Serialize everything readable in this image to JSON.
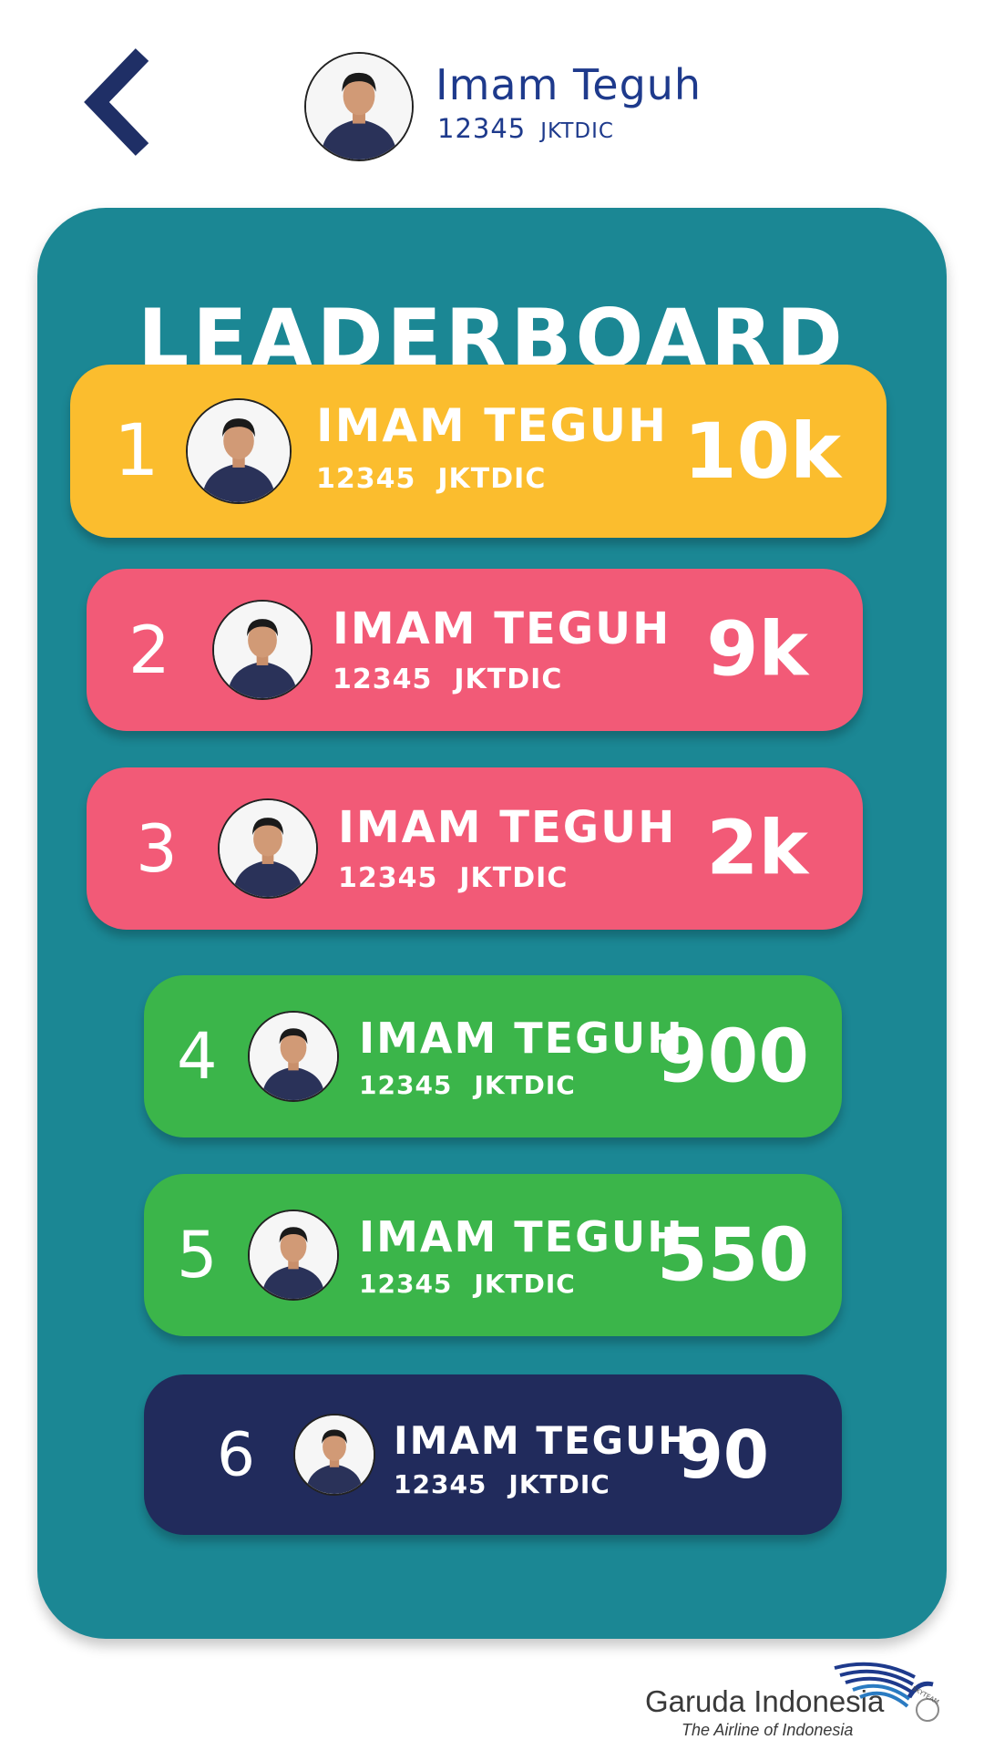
{
  "header": {
    "name": "Imam Teguh",
    "employee_id": "12345",
    "station": "JKTDIC"
  },
  "leaderboard": {
    "title": "LEADERBOARD",
    "entries": [
      {
        "rank": "1",
        "name": "IMAM TEGUH",
        "employee_id": "12345",
        "station": "JKTDIC",
        "score": "10k",
        "color": "#fbbd2e"
      },
      {
        "rank": "2",
        "name": "IMAM TEGUH",
        "employee_id": "12345",
        "station": "JKTDIC",
        "score": "9k",
        "color": "#f25a77"
      },
      {
        "rank": "3",
        "name": "IMAM TEGUH",
        "employee_id": "12345",
        "station": "JKTDIC",
        "score": "2k",
        "color": "#f25a77"
      },
      {
        "rank": "4",
        "name": "IMAM TEGUH",
        "employee_id": "12345",
        "station": "JKTDIC",
        "score": "900",
        "color": "#3bb54a"
      },
      {
        "rank": "5",
        "name": "IMAM TEGUH",
        "employee_id": "12345",
        "station": "JKTDIC",
        "score": "550",
        "color": "#3bb54a"
      },
      {
        "rank": "6",
        "name": "IMAM TEGUH",
        "employee_id": "12345",
        "station": "JKTDIC",
        "score": "90",
        "color": "#212b5c"
      }
    ]
  },
  "brand": {
    "name": "Garuda Indonesia",
    "tagline": "The Airline of Indonesia",
    "logo_text": "SKYTEAM"
  },
  "colors": {
    "panel": "#1b8794",
    "header_text": "#1e3a8c",
    "back_chevron": "#1f2f66"
  },
  "icons": {
    "back": "chevron-left-icon",
    "avatar": "user-photo"
  }
}
